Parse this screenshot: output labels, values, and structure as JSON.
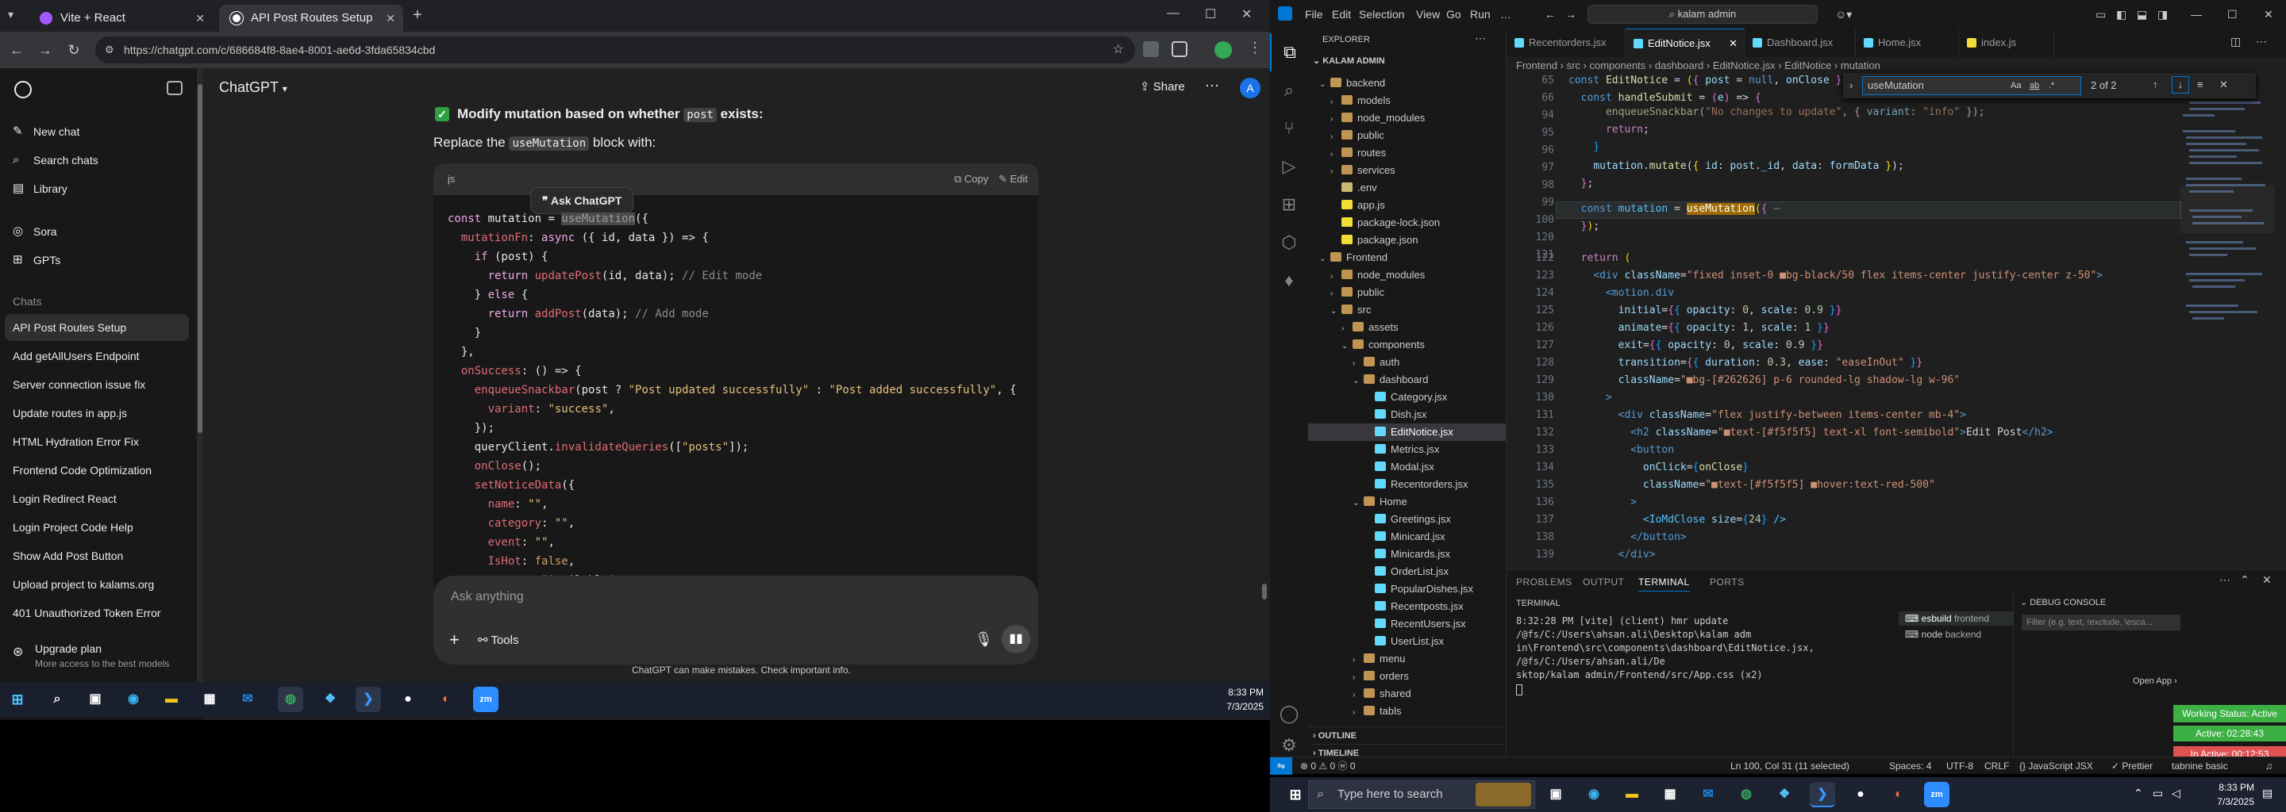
{
  "chrome": {
    "tabs": [
      {
        "label": "Vite + React",
        "active": false
      },
      {
        "label": "API Post Routes Setup",
        "active": true
      }
    ],
    "new_tab": "+",
    "url": "https://chatgpt.com/c/686684f8-8ae4-8001-ae6d-3fda65834cbd",
    "window_controls": {
      "minimize": "—",
      "maximize": "☐",
      "close": "✕"
    }
  },
  "chatgpt": {
    "sidebar": {
      "actions": [
        {
          "icon": "✎",
          "label": "New chat"
        },
        {
          "icon": "⌕",
          "label": "Search chats"
        },
        {
          "icon": "▤",
          "label": "Library"
        }
      ],
      "apps": [
        {
          "icon": "◎",
          "label": "Sora"
        },
        {
          "icon": "⊞",
          "label": "GPTs"
        }
      ],
      "chats_heading": "Chats",
      "chats": [
        "API Post Routes Setup",
        "Add getAllUsers Endpoint",
        "Server connection issue fix",
        "Update routes in app.js",
        "HTML Hydration Error Fix",
        "Frontend Code Optimization",
        "Login Redirect React",
        "Login Project Code Help",
        "Show Add Post Button",
        "Upload project to kalams.org",
        "401 Unauthorized Token Error"
      ],
      "upgrade_title": "Upgrade plan",
      "upgrade_sub": "More access to the best models"
    },
    "header": {
      "model": "ChatGPT",
      "share": "Share",
      "avatar_letter": "A"
    },
    "message": {
      "check_icon": "✓",
      "title_pre": "Modify mutation based on whether ",
      "title_code": "post",
      "title_post": " exists:",
      "replace_pre": "Replace the ",
      "replace_code": "useMutation",
      "replace_post": " block with:"
    },
    "codeblock": {
      "lang": "js",
      "ask_chip": "Ask ChatGPT",
      "copy": "Copy",
      "edit": "Edit"
    },
    "composer": {
      "placeholder": "Ask anything",
      "plus": "+",
      "tools": "Tools"
    },
    "disclaimer": "ChatGPT can make mistakes. Check important info."
  },
  "left_taskbar": {
    "time": "8:33 PM",
    "date": "7/3/2025"
  },
  "vscode": {
    "menu": [
      "File",
      "Edit",
      "Selection",
      "View",
      "Go",
      "Run",
      "…"
    ],
    "search": "kalam admin",
    "explorer_title": "EXPLORER",
    "root": "KALAM ADMIN",
    "tree": [
      {
        "depth": 0,
        "kind": "folder",
        "open": true,
        "label": "backend"
      },
      {
        "depth": 1,
        "kind": "folder",
        "open": false,
        "label": "models"
      },
      {
        "depth": 1,
        "kind": "folder",
        "open": false,
        "label": "node_modules"
      },
      {
        "depth": 1,
        "kind": "folder",
        "open": false,
        "label": "public"
      },
      {
        "depth": 1,
        "kind": "folder",
        "open": false,
        "label": "routes"
      },
      {
        "depth": 1,
        "kind": "folder",
        "open": false,
        "label": "services"
      },
      {
        "depth": 1,
        "kind": "env",
        "label": ".env"
      },
      {
        "depth": 1,
        "kind": "js",
        "label": "app.js"
      },
      {
        "depth": 1,
        "kind": "json",
        "label": "package-lock.json"
      },
      {
        "depth": 1,
        "kind": "json",
        "label": "package.json"
      },
      {
        "depth": 0,
        "kind": "folder",
        "open": true,
        "label": "Frontend"
      },
      {
        "depth": 1,
        "kind": "folder",
        "open": false,
        "label": "node_modules"
      },
      {
        "depth": 1,
        "kind": "folder",
        "open": false,
        "label": "public"
      },
      {
        "depth": 1,
        "kind": "folder",
        "open": true,
        "label": "src"
      },
      {
        "depth": 2,
        "kind": "folder",
        "open": false,
        "label": "assets"
      },
      {
        "depth": 2,
        "kind": "folder",
        "open": true,
        "label": "components"
      },
      {
        "depth": 3,
        "kind": "folder",
        "open": false,
        "label": "auth"
      },
      {
        "depth": 3,
        "kind": "folder",
        "open": true,
        "label": "dashboard"
      },
      {
        "depth": 4,
        "kind": "jsx",
        "label": "Category.jsx"
      },
      {
        "depth": 4,
        "kind": "jsx",
        "label": "Dish.jsx"
      },
      {
        "depth": 4,
        "kind": "jsx",
        "label": "EditNotice.jsx",
        "selected": true
      },
      {
        "depth": 4,
        "kind": "jsx",
        "label": "Metrics.jsx"
      },
      {
        "depth": 4,
        "kind": "jsx",
        "label": "Modal.jsx"
      },
      {
        "depth": 4,
        "kind": "jsx",
        "label": "Recentorders.jsx"
      },
      {
        "depth": 3,
        "kind": "folder",
        "open": true,
        "label": "Home"
      },
      {
        "depth": 4,
        "kind": "jsx",
        "label": "Greetings.jsx"
      },
      {
        "depth": 4,
        "kind": "jsx",
        "label": "Minicard.jsx"
      },
      {
        "depth": 4,
        "kind": "jsx",
        "label": "Minicards.jsx"
      },
      {
        "depth": 4,
        "kind": "jsx",
        "label": "OrderList.jsx"
      },
      {
        "depth": 4,
        "kind": "jsx",
        "label": "PopularDishes.jsx"
      },
      {
        "depth": 4,
        "kind": "jsx",
        "label": "Recentposts.jsx"
      },
      {
        "depth": 4,
        "kind": "jsx",
        "label": "RecentUsers.jsx"
      },
      {
        "depth": 4,
        "kind": "jsx",
        "label": "UserList.jsx"
      },
      {
        "depth": 3,
        "kind": "folder",
        "open": false,
        "label": "menu"
      },
      {
        "depth": 3,
        "kind": "folder",
        "open": false,
        "label": "orders"
      },
      {
        "depth": 3,
        "kind": "folder",
        "open": false,
        "label": "shared"
      },
      {
        "depth": 3,
        "kind": "folder",
        "open": false,
        "label": "tabls"
      }
    ],
    "outline": "OUTLINE",
    "timeline": "TIMELINE",
    "tabs": [
      {
        "label": "Recentorders.jsx",
        "active": false
      },
      {
        "label": "EditNotice.jsx",
        "active": true
      },
      {
        "label": "Dashboard.jsx",
        "active": false
      },
      {
        "label": "Home.jsx",
        "active": false
      },
      {
        "label": "index.js",
        "active": false
      }
    ],
    "breadcrumbs": "Frontend › src › components › dashboard › EditNotice.jsx › EditNotice › mutation",
    "find": {
      "query": "useMutation",
      "aa": "Aa",
      "ab": "ab",
      "re": ".*",
      "count": "2 of 2"
    },
    "panel_tabs": [
      "PROBLEMS",
      "OUTPUT",
      "TERMINAL",
      "PORTS"
    ],
    "terminal_label": "TERMINAL",
    "terminal_lines": [
      "8:32:28 PM [vite] (client) hmr update /@fs/C:/Users\\ahsan.ali\\Desktop\\kalam adm",
      "in\\Frontend\\src\\components\\dashboard\\EditNotice.jsx, /@fs/C:/Users/ahsan.ali/De",
      "sktop/kalam admin/Frontend/src/App.css (x2)"
    ],
    "terminals": [
      {
        "label": "esbuild",
        "sub": "frontend"
      },
      {
        "label": "node",
        "sub": "backend"
      }
    ],
    "debug_console": "DEBUG CONSOLE",
    "debug_filter": "Filter (e.g. text, !exclude, \\esca...",
    "open_app": "Open App ›",
    "working_status": "Working Status: Active",
    "active_time": "Active: 02:28:43",
    "inactive_time": "In Active: 00:12:53",
    "status": {
      "left": "⊗ 0  ⚠ 0    ⓦ 0",
      "position": "Ln 100, Col 31 (11 selected)",
      "spaces": "Spaces: 4",
      "encoding": "UTF-8",
      "eol": "CRLF",
      "lang": "{} JavaScript JSX",
      "prettier": "✓ Prettier",
      "tabnine": "tabnine basic"
    }
  },
  "right_taskbar": {
    "search_placeholder": "Type here to search",
    "time": "8:33 PM",
    "date": "7/3/2025"
  },
  "colors": {
    "chrome_bg": "#212121",
    "vscode_bg": "#1f1f1f",
    "find_highlight": "#9e6a03",
    "status_green": "#3cb043",
    "status_red": "#e05252",
    "accent_blue": "#0078d4"
  }
}
